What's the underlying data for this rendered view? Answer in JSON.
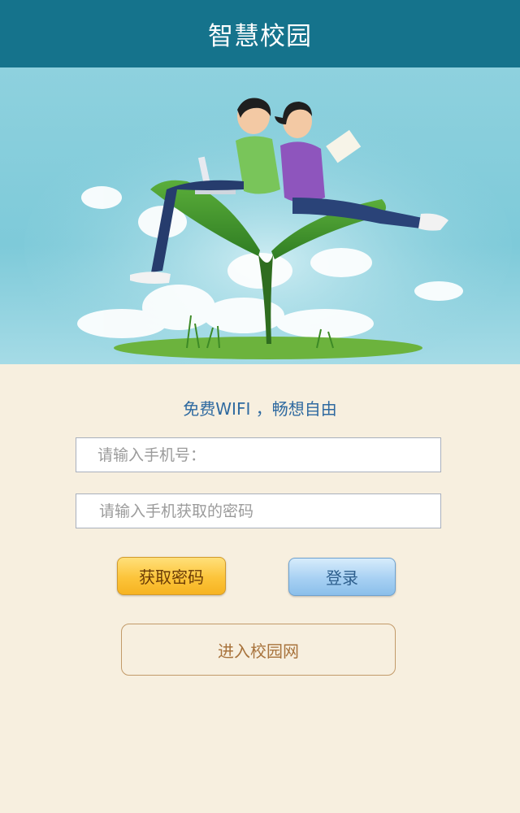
{
  "header": {
    "title": "智慧校园"
  },
  "banner": {
    "image": "students-on-leaf-illustration"
  },
  "slogan": "免费WIFI ，畅想自由",
  "form": {
    "phone_placeholder": "请输入手机号：",
    "code_placeholder": "请输入手机获取的密码"
  },
  "buttons": {
    "get_code": "获取密码",
    "login": "登录",
    "enter_campus": "进入校园网"
  },
  "colors": {
    "header_bg": "#15738c",
    "page_bg": "#f7efdf",
    "slogan": "#2f6aa0",
    "get_code_btn": "#fcc43a",
    "login_btn": "#a7d0f3",
    "enter_border": "#c29a69"
  }
}
